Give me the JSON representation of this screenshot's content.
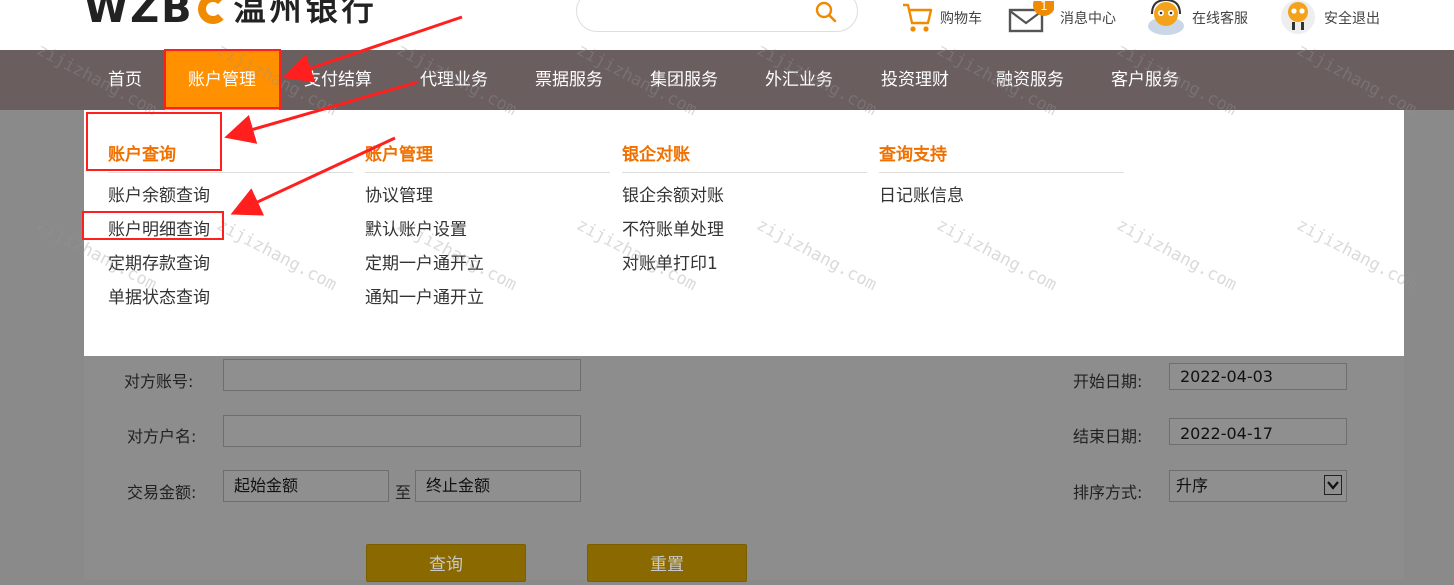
{
  "header": {
    "logo_latin": "WZB",
    "logo_cn": "温州银行",
    "cart_label": "购物车",
    "message_label": "消息中心",
    "service_label": "在线客服",
    "logout_label": "安全退出"
  },
  "nav": {
    "items": [
      "首页",
      "账户管理",
      "支付结算",
      "代理业务",
      "票据服务",
      "集团服务",
      "外汇业务",
      "投资理财",
      "融资服务",
      "客户服务"
    ],
    "active_index": 1
  },
  "dropdown": {
    "columns": [
      {
        "heading": "账户查询",
        "items": [
          "账户余额查询",
          "账户明细查询",
          "定期存款查询",
          "单据状态查询"
        ]
      },
      {
        "heading": "账户管理",
        "items": [
          "协议管理",
          "默认账户设置",
          "定期一户通开立",
          "通知一户通开立"
        ]
      },
      {
        "heading": "银企对账",
        "items": [
          "银企余额对账",
          "不符账单处理",
          "对账单打印1"
        ]
      },
      {
        "heading": "查询支持",
        "items": [
          "日记账信息"
        ]
      }
    ]
  },
  "form": {
    "counterparty_account_label": "对方账号:",
    "counterparty_name_label": "对方户名:",
    "amount_label": "交易金额:",
    "amount_min_placeholder": "起始金额",
    "amount_to": "至",
    "amount_max_placeholder": "终止金额",
    "start_date_label": "开始日期:",
    "start_date_value": "2022-04-03",
    "end_date_label": "结束日期:",
    "end_date_value": "2022-04-17",
    "sort_label": "排序方式:",
    "sort_value": "升序",
    "query_button": "查询",
    "reset_button": "重置"
  },
  "watermark": "zijizhang.com",
  "colors": {
    "nav_bg": "#6a5e5f",
    "nav_active": "#ff9000",
    "heading_orange": "#f07000",
    "highlight_red": "#ff1f1f"
  }
}
